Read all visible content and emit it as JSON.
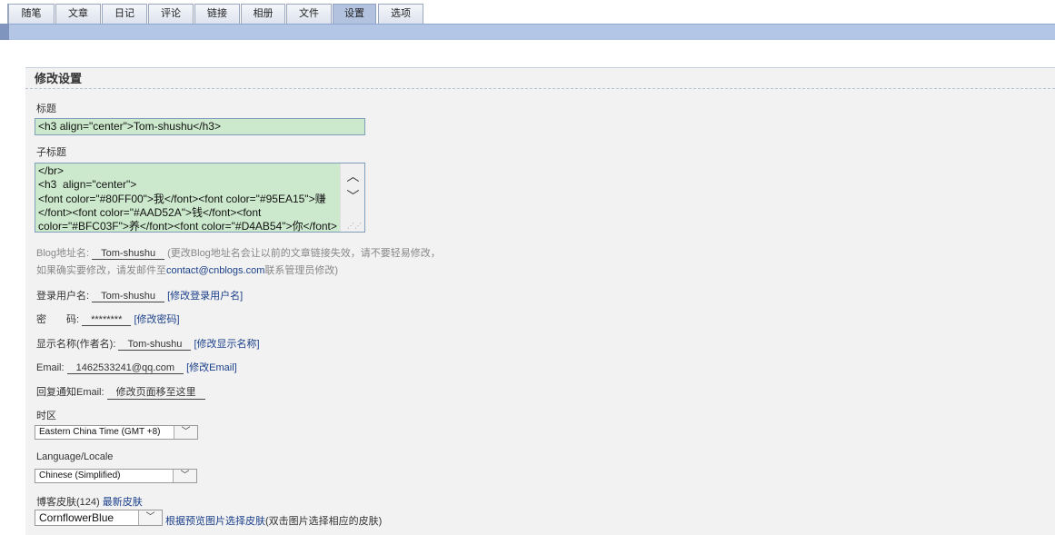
{
  "tabs": [
    {
      "label": "随笔"
    },
    {
      "label": "文章"
    },
    {
      "label": "日记"
    },
    {
      "label": "评论"
    },
    {
      "label": "链接"
    },
    {
      "label": "相册"
    },
    {
      "label": "文件"
    },
    {
      "label": "设置"
    },
    {
      "label": "选项"
    }
  ],
  "active_tab": "设置",
  "section_title": "修改设置",
  "title_field": {
    "label": "标题",
    "value": "<h3   align=\"center\">Tom-shushu</h3>"
  },
  "subtitle_field": {
    "label": "子标题",
    "value": "</br>\n<h3  align=\"center\">\n<font color=\"#80FF00\">我</font><font color=\"#95EA15\">赚\n</font><font color=\"#AAD52A\">钱</font><font\ncolor=\"#BFC03F\">养</font><font color=\"#D4AB54\">你</font>"
  },
  "blog_address": {
    "label": "Blog地址名:",
    "value": "Tom-shushu",
    "hint1": "(更改Blog地址名会让以前的文章链接失效，请不要轻易修改，",
    "hint2_prefix": "如果确实要修改，请发邮件至",
    "email_link": "contact@cnblogs.com",
    "hint2_suffix": "联系管理员修改)"
  },
  "login_name": {
    "label": "登录用户名:",
    "value": "Tom-shushu",
    "link": "[修改登录用户名]"
  },
  "password": {
    "label": "密　　码:",
    "value": "********",
    "link": "[修改密码]"
  },
  "display_name": {
    "label": "显示名称(作者名):",
    "value": "Tom-shushu",
    "link": "[修改显示名称]"
  },
  "email": {
    "label": "Email:",
    "value": "1462533241@qq.com",
    "link": "[修改Email]"
  },
  "reply_email": {
    "label": "回复通知Email:",
    "value": "修改页面移至这里"
  },
  "timezone": {
    "label": "时区",
    "value": "Eastern China Time (GMT +8)"
  },
  "language": {
    "label": "Language/Locale",
    "value": "Chinese (Simplified)"
  },
  "skin": {
    "label": "博客皮肤(124)",
    "newest_link": "最新皮肤",
    "value": "CornflowerBlue",
    "preview_link": "根据预览图片选择皮肤",
    "preview_hint": "(双击图片选择相应的皮肤)"
  },
  "colors": {
    "accent_bar": "#b3c6e6",
    "textarea_bg": "#cde9cd",
    "link": "#1a3f8a"
  }
}
